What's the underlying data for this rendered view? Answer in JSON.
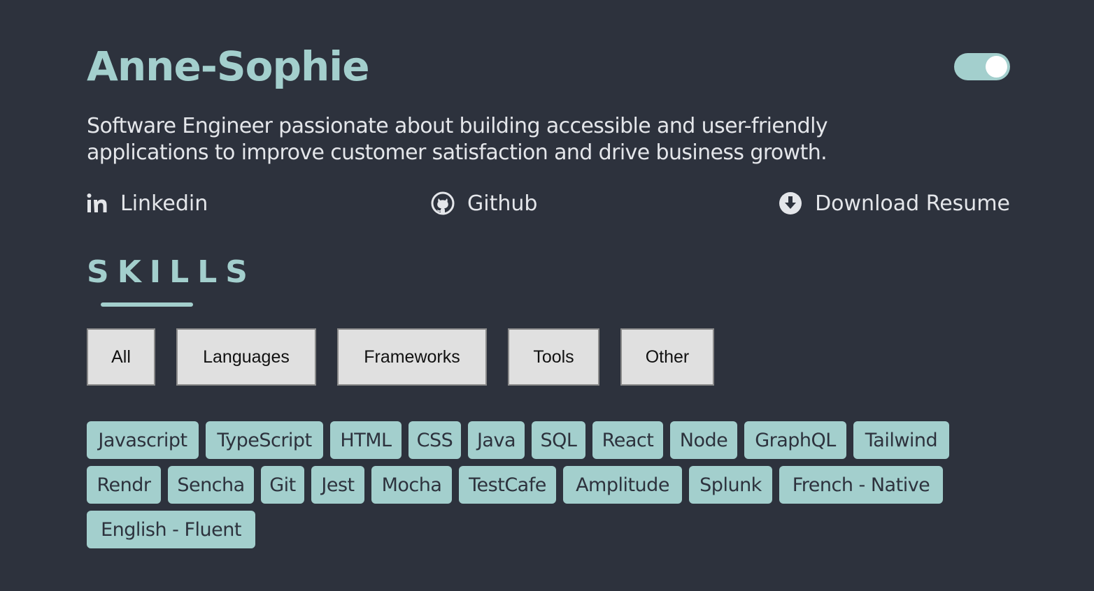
{
  "profile": {
    "name": "Anne-Sophie",
    "bio_line1": "Software Engineer passionate about building accessible and user-friendly",
    "bio_line2": "applications to improve customer satisfaction and drive business growth."
  },
  "theme_toggle": {
    "checked": true
  },
  "links": {
    "linkedin": {
      "label": "Linkedin",
      "icon": "linkedin-icon"
    },
    "github": {
      "label": "Github",
      "icon": "github-icon"
    },
    "resume": {
      "label": "Download Resume",
      "icon": "download-icon"
    }
  },
  "skills": {
    "title": "SKILLS",
    "filters": [
      "All",
      "Languages",
      "Frameworks",
      "Tools",
      "Other"
    ],
    "tags": [
      "Javascript",
      "TypeScript",
      "HTML",
      "CSS",
      "Java",
      "SQL",
      "React",
      "Node",
      "GraphQL",
      "Tailwind",
      "Rendr",
      "Sencha",
      "Git",
      "Jest",
      "Mocha",
      "TestCafe",
      "Amplitude",
      "Splunk",
      "French - Native",
      "English - Fluent"
    ]
  },
  "colors": {
    "background": "#2d323d",
    "accent": "#a3cfcd",
    "text": "#e4e6ea",
    "filter_bg": "#e0e0e0"
  }
}
